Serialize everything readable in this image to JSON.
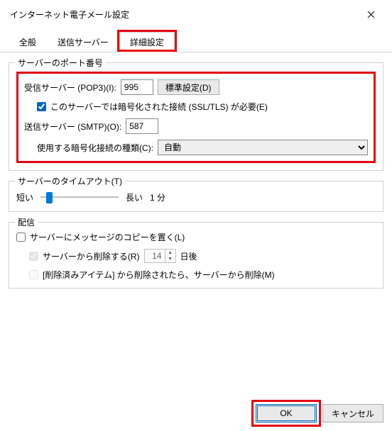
{
  "window": {
    "title": "インターネット電子メール設定"
  },
  "tabs": {
    "general": "全般",
    "outgoing": "送信サーバー",
    "advanced": "詳細設定"
  },
  "serverPorts": {
    "groupTitle": "サーバーのポート番号",
    "pop3Label": "受信サーバー (POP3)(I):",
    "pop3Value": "995",
    "defaultsBtn": "標準設定(D)",
    "sslCheckboxLabel": "このサーバーでは暗号化された接続 (SSL/TLS) が必要(E)",
    "sslChecked": true,
    "smtpLabel": "送信サーバー (SMTP)(O):",
    "smtpValue": "587",
    "encryptionLabel": "使用する暗号化接続の種類(C):",
    "encryptionValue": "自動"
  },
  "timeout": {
    "groupTitle": "サーバーのタイムアウト(T)",
    "shortLabel": "短い",
    "longLabel": "長い",
    "valueText": "1 分"
  },
  "delivery": {
    "groupTitle": "配信",
    "leaveCopyLabel": "サーバーにメッセージのコピーを置く(L)",
    "leaveCopyChecked": false,
    "removeAfterLabel": "サーバーから削除する(R)",
    "removeAfterDays": "14",
    "daysSuffix": "日後",
    "removeDeletedLabel": "[削除済みアイテム] から削除されたら、サーバーから削除(M)"
  },
  "footer": {
    "ok": "OK",
    "cancel": "キャンセル"
  }
}
